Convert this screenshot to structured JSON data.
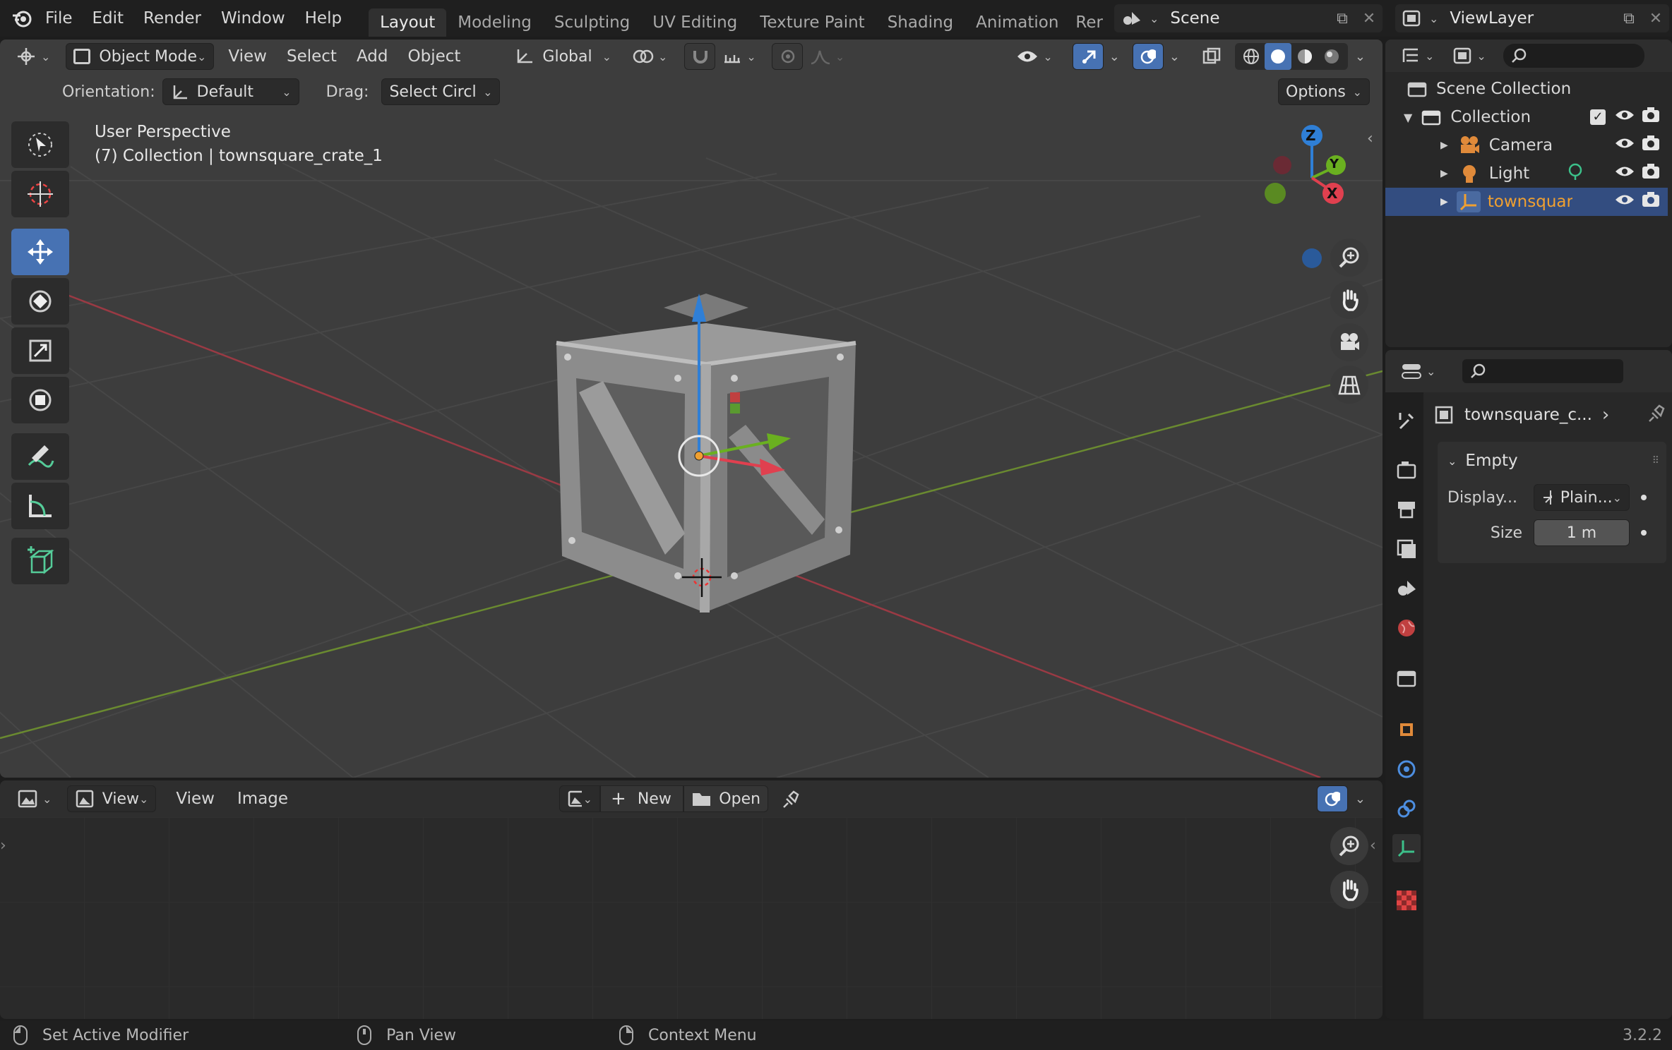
{
  "menubar": {
    "file": "File",
    "edit": "Edit",
    "render": "Render",
    "window": "Window",
    "help": "Help"
  },
  "workspaces": [
    "Layout",
    "Modeling",
    "Sculpting",
    "UV Editing",
    "Texture Paint",
    "Shading",
    "Animation",
    "Rer"
  ],
  "scene_name": "Scene",
  "view_layer": "ViewLayer",
  "viewport_header": {
    "mode": "Object Mode",
    "view": "View",
    "select": "Select",
    "add": "Add",
    "object": "Object",
    "transform_orientation": "Global"
  },
  "tool_settings": {
    "orientation_label": "Orientation:",
    "orientation_value": "Default",
    "drag_label": "Drag:",
    "drag_value": "Select Circl",
    "options": "Options"
  },
  "viewport": {
    "perspective": "User Perspective",
    "collection_info": "(7) Collection | townsquare_crate_1"
  },
  "gizmo": {
    "z": "Z",
    "y": "Y",
    "x": "X"
  },
  "outliner": {
    "scene_collection": "Scene Collection",
    "collection": "Collection",
    "items": [
      "Camera",
      "Light",
      "townsquare"
    ]
  },
  "properties": {
    "object_name": "townsquare_c...",
    "panel_title": "Empty",
    "display_label": "Display...",
    "display_value": "Plain...",
    "size_label": "Size",
    "size_value": "1 m"
  },
  "image_editor": {
    "view1": "View",
    "view2": "View",
    "image": "Image",
    "new": "New",
    "open": "Open"
  },
  "statusbar": {
    "left": "Set Active Modifier",
    "middle": "Pan View",
    "right": "Context Menu",
    "version": "3.2.2"
  },
  "colors": {
    "accent_blue": "#4772b3",
    "x_axis": "#d04050",
    "y_axis": "#6a9a2a",
    "z_axis": "#2f7fd6",
    "selected_orange": "#f0a030"
  }
}
